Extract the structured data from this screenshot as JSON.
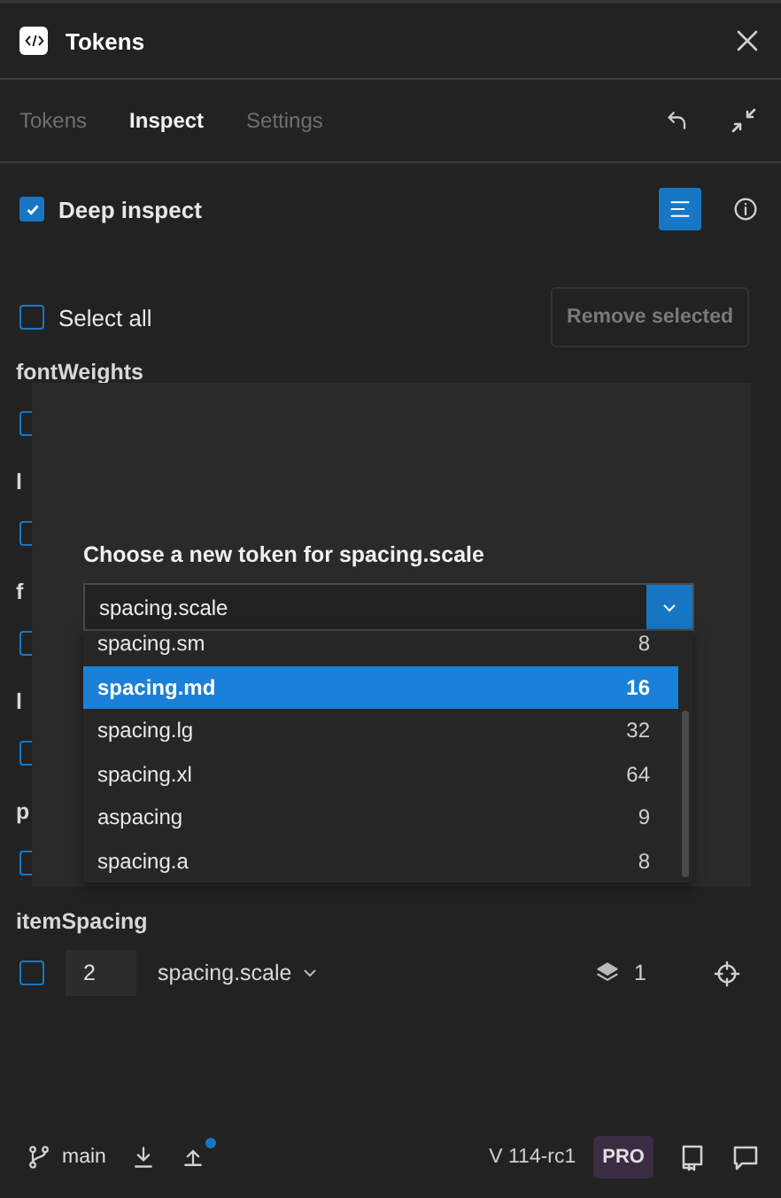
{
  "window": {
    "title": "Tokens"
  },
  "tabs": [
    {
      "label": "Tokens",
      "selected": false
    },
    {
      "label": "Inspect",
      "selected": true
    },
    {
      "label": "Settings",
      "selected": false
    }
  ],
  "deep_inspect": {
    "label": "Deep inspect",
    "checked": true
  },
  "select_all": {
    "label": "Select all",
    "checked": false
  },
  "remove_button": "Remove selected",
  "groups": [
    {
      "heading": "fontWeights",
      "rows": [
        {
          "checked": false
        }
      ]
    },
    {
      "heading": "l",
      "rows": [
        {
          "checked": false
        }
      ]
    },
    {
      "heading": "f",
      "rows": [
        {
          "checked": false
        }
      ]
    },
    {
      "heading": "l",
      "rows": [
        {
          "checked": false
        }
      ]
    },
    {
      "heading": "p",
      "rows": [
        {
          "checked": false
        }
      ]
    },
    {
      "heading": "itemSpacing",
      "rows": [
        {
          "checked": false,
          "value": "2",
          "token": "spacing.scale",
          "count": "1"
        }
      ]
    }
  ],
  "modal": {
    "title": "Choose a new token for spacing.scale",
    "select_value": "spacing.scale",
    "options": [
      {
        "name": "spacing.sm",
        "value": "8",
        "selected": false
      },
      {
        "name": "spacing.md",
        "value": "16",
        "selected": true
      },
      {
        "name": "spacing.lg",
        "value": "32",
        "selected": false
      },
      {
        "name": "spacing.xl",
        "value": "64",
        "selected": false
      },
      {
        "name": "aspacing",
        "value": "9",
        "selected": false
      },
      {
        "name": "spacing.a",
        "value": "8",
        "selected": false
      }
    ]
  },
  "footer": {
    "branch": "main",
    "push_pending": true,
    "version": "V 114-rc1",
    "badge": "PRO"
  }
}
